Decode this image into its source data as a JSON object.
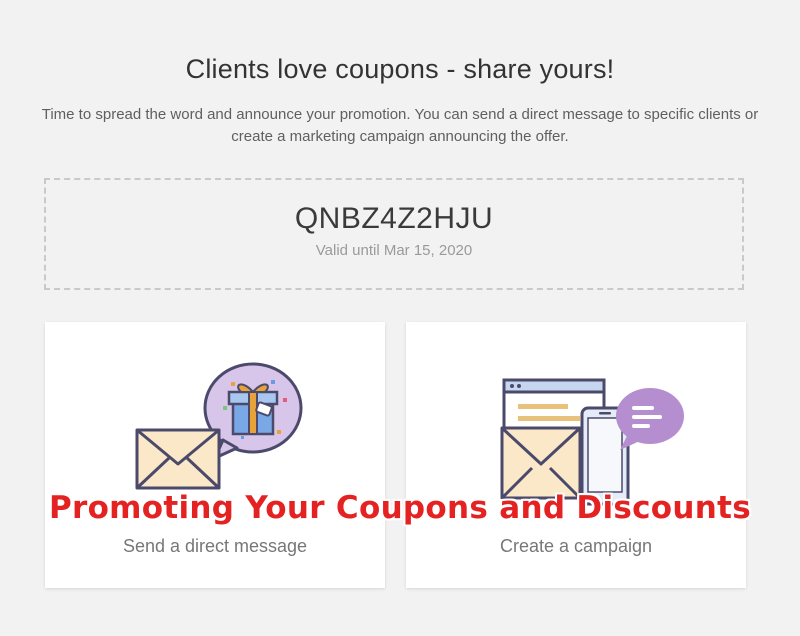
{
  "header": {
    "title": "Clients love coupons - share yours!",
    "description": "Time to spread the word and announce your promotion. You can send a direct message to specific clients or create a marketing campaign announcing the offer."
  },
  "coupon": {
    "code": "QNBZ4Z2HJU",
    "validity": "Valid until Mar 15, 2020"
  },
  "options": [
    {
      "label": "Send a direct message",
      "icon": "envelope-gift-icon"
    },
    {
      "label": "Create a campaign",
      "icon": "envelope-phone-icon"
    }
  ],
  "overlay": {
    "caption": "Promoting Your Coupons and Discounts"
  },
  "colors": {
    "background": "#f2f2f2",
    "overlay_text": "#e52222",
    "envelope": "#fbe8c8",
    "outline": "#4b4a6b",
    "bubble": "#d8c6ea"
  }
}
